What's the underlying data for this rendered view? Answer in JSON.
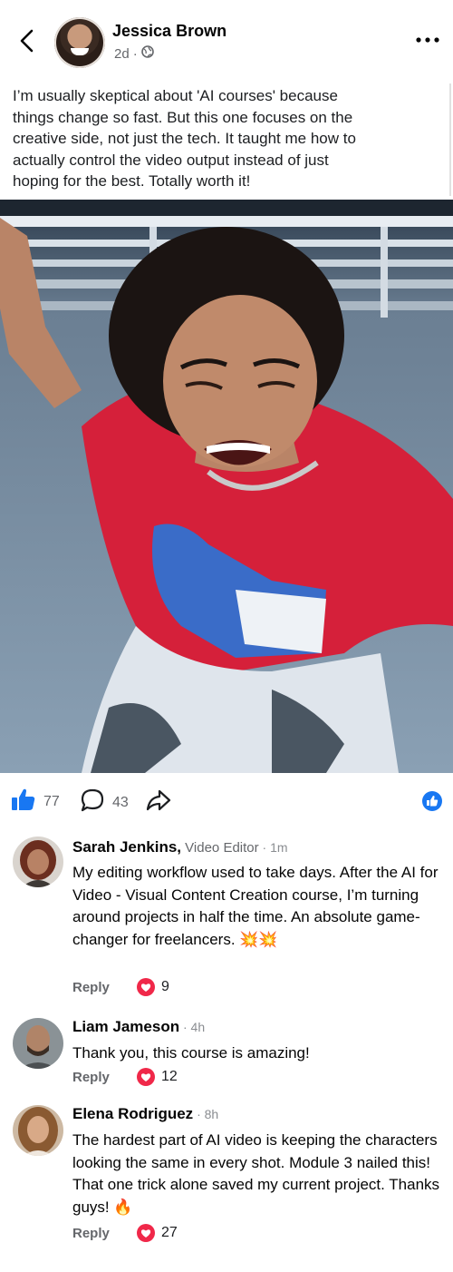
{
  "post": {
    "author": "Jessica Brown",
    "time": "2d",
    "separator": "·",
    "text": "I’m usually skeptical about 'AI courses' because\nthings change so fast. But this one focuses on the\ncreative side, not just the tech. It taught me how to\nactually control the video output instead of just\nhoping for the best. Totally worth it!",
    "likes": "77",
    "comments": "43"
  },
  "icons": {
    "back": "back-arrow-icon",
    "more": "more-options-icon",
    "globe": "globe-icon",
    "like": "thumbs-up-icon",
    "comment": "comment-bubble-icon",
    "share": "share-arrow-icon",
    "heart": "heart-reaction-icon"
  },
  "colors": {
    "brand_blue": "#1877f2",
    "heart_red": "#f02849",
    "muted": "#65676b"
  },
  "comments": [
    {
      "name": "Sarah Jenkins,",
      "role": " Video Editor",
      "time": " · 1m",
      "body": "My editing workflow used to take days. After the AI for Video - Visual Content Creation course, I’m turning around projects in half the time. An absolute game-changer for freelancers. ",
      "emoji": "💥💥",
      "reply": "Reply",
      "hearts": "9"
    },
    {
      "name": "Liam Jameson",
      "role": "",
      "time": " · 4h",
      "body": "Thank you, this course is amazing!",
      "emoji": "",
      "reply": "Reply",
      "hearts": "12"
    },
    {
      "name": "Elena Rodriguez",
      "role": "",
      "time": " · 8h",
      "body": "The hardest part of AI video is keeping the characters looking the same in every shot. Module 3 nailed this! That one trick alone saved my current project. Thanks guys! ",
      "emoji": "🔥",
      "reply": "Reply",
      "hearts": "27"
    }
  ]
}
